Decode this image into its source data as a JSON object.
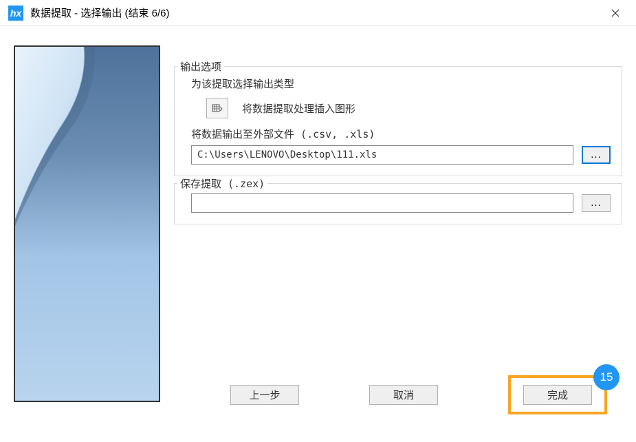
{
  "titlebar": {
    "title": "数据提取 - 选择输出 (结束 6/6)",
    "icon_label": "hx"
  },
  "outputOptions": {
    "groupLabel": "输出选项",
    "subtitle": "为该提取选择输出类型",
    "insertAction": "将数据提取处理插入图形",
    "externalFileLabel": "将数据输出至外部文件 (.csv, .xls)",
    "filePath": "C:\\Users\\LENOVO\\Desktop\\111.xls",
    "browse1": "..."
  },
  "saveExtract": {
    "groupLabel": "保存提取 (.zex)",
    "filePath": "",
    "browse2": "..."
  },
  "footer": {
    "back": "上一步",
    "cancel": "取消",
    "finish": "完成"
  },
  "annotation": {
    "stepNumber": "15"
  }
}
